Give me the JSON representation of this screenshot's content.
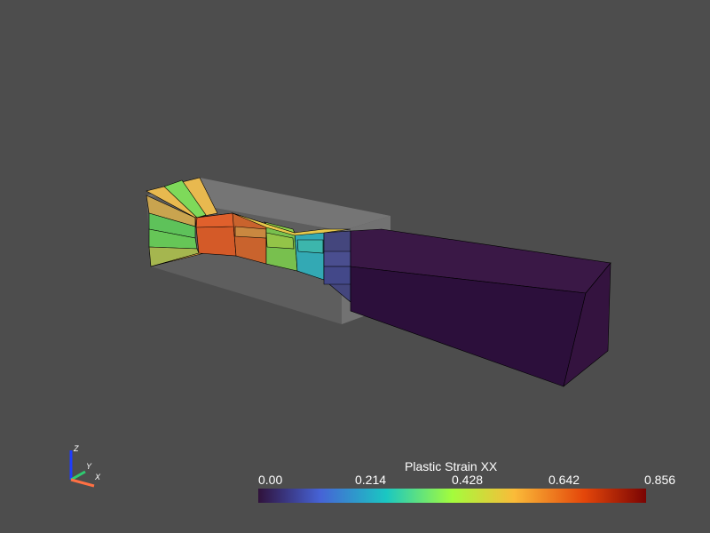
{
  "scalar_bar": {
    "title": "Plastic Strain XX",
    "ticks": [
      "0.00",
      "0.214",
      "0.428",
      "0.642",
      "0.856"
    ],
    "range": [
      0.0,
      0.856
    ],
    "colormap": [
      "#30123b",
      "#4663d6",
      "#1ac7c2",
      "#a4fc3c",
      "#fabb39",
      "#e4460a",
      "#7a0403"
    ]
  },
  "orientation_axes": {
    "x_label": "X",
    "y_label": "Y",
    "z_label": "Z",
    "x_color": "#ff7043",
    "y_color": "#2ecc71",
    "z_color": "#1e3cff"
  },
  "scene": {
    "background": "#4d4d4d",
    "outline_color": "#9a9a9a",
    "mesh_edge_color": "#000000"
  }
}
